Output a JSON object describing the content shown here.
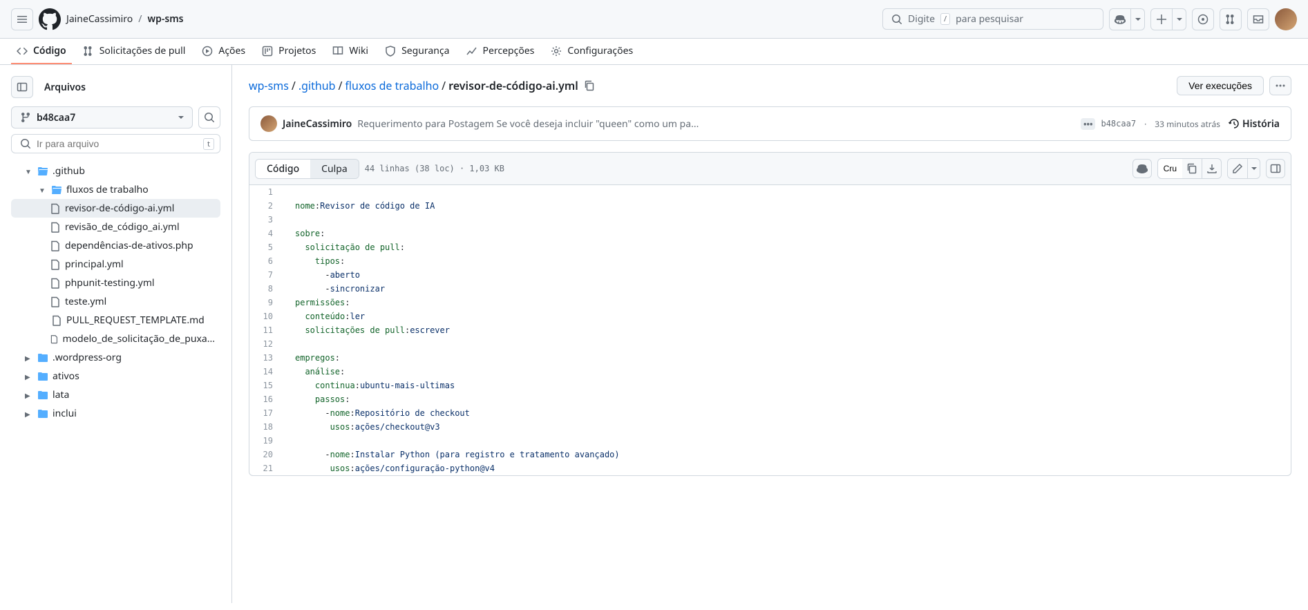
{
  "header": {
    "owner": "JaineCassimiro",
    "repo": "wp-sms",
    "search_placeholder_pre": "Digite",
    "search_placeholder_post": "para pesquisar",
    "search_kbd": "/"
  },
  "nav": {
    "code": "Código",
    "pulls": "Solicitações de pull",
    "actions": "Ações",
    "projects": "Projetos",
    "wiki": "Wiki",
    "security": "Segurança",
    "insights": "Percepções",
    "settings": "Configurações"
  },
  "sidebar": {
    "title": "Arquivos",
    "branch": "b48caa7",
    "filter_placeholder": "Ir para arquivo",
    "filter_kbd": "t",
    "tree": {
      "github": ".github",
      "workflows": "fluxos de trabalho",
      "files": {
        "ai_reviewer": "revisor-de-código-ai.yml",
        "ai_review": "revisão_de_código_ai.yml",
        "asset_deps": "dependências-de-ativos.php",
        "main": "principal.yml",
        "phpunit": "phpunit-testing.yml",
        "test": "teste.yml",
        "pr_template": "PULL_REQUEST_TEMPLATE.md",
        "pr_model": "modelo_de_solicitação_de_puxa..."
      },
      "wordpress_org": ".wordpress-org",
      "ativos": "ativos",
      "lata": "lata",
      "inclui": "inclui"
    }
  },
  "path": {
    "root": "wp-sms",
    "github": ".github",
    "workflows": "fluxos de trabalho",
    "file": "revisor-de-código-ai.yml",
    "run_btn": "Ver execuções"
  },
  "commit": {
    "author": "JaineCassimiro",
    "message": "Requerimento para Postagem Se você deseja incluir \"queen\" como um pa...",
    "sha": "b48caa7",
    "time": "33 minutos atrás",
    "history": "História"
  },
  "file_toolbar": {
    "code": "Código",
    "blame": "Culpa",
    "info": "44 linhas (38 loc) · 1,03 KB",
    "raw": "Cru"
  },
  "code_lines": [
    {
      "n": 1,
      "segs": []
    },
    {
      "n": 2,
      "segs": [
        {
          "t": "nome",
          "c": "tk-key"
        },
        {
          "t": ":",
          "c": "tk-punc"
        },
        {
          "t": "Revisor de código de IA",
          "c": "tk-val"
        }
      ]
    },
    {
      "n": 3,
      "segs": []
    },
    {
      "n": 4,
      "segs": [
        {
          "t": "sobre",
          "c": "tk-key"
        },
        {
          "t": ":",
          "c": "tk-punc"
        }
      ]
    },
    {
      "n": 5,
      "segs": [
        {
          "t": "  ",
          "c": ""
        },
        {
          "t": "solicitação de pull",
          "c": "tk-key"
        },
        {
          "t": ":",
          "c": "tk-punc"
        }
      ]
    },
    {
      "n": 6,
      "segs": [
        {
          "t": "    ",
          "c": ""
        },
        {
          "t": "tipos",
          "c": "tk-key"
        },
        {
          "t": ":",
          "c": "tk-punc"
        }
      ]
    },
    {
      "n": 7,
      "segs": [
        {
          "t": "      -",
          "c": "tk-punc"
        },
        {
          "t": "aberto",
          "c": "tk-val"
        }
      ]
    },
    {
      "n": 8,
      "segs": [
        {
          "t": "      -",
          "c": "tk-punc"
        },
        {
          "t": "sincronizar",
          "c": "tk-val"
        }
      ]
    },
    {
      "n": 9,
      "segs": [
        {
          "t": "permissões",
          "c": "tk-key"
        },
        {
          "t": ":",
          "c": "tk-punc"
        }
      ]
    },
    {
      "n": 10,
      "segs": [
        {
          "t": "  ",
          "c": ""
        },
        {
          "t": "conteúdo",
          "c": "tk-key"
        },
        {
          "t": ":",
          "c": "tk-punc"
        },
        {
          "t": "ler",
          "c": "tk-val"
        }
      ]
    },
    {
      "n": 11,
      "segs": [
        {
          "t": "  ",
          "c": ""
        },
        {
          "t": "solicitações de pull",
          "c": "tk-key"
        },
        {
          "t": ":",
          "c": "tk-punc"
        },
        {
          "t": "escrever",
          "c": "tk-val"
        }
      ]
    },
    {
      "n": 12,
      "segs": []
    },
    {
      "n": 13,
      "segs": [
        {
          "t": "empregos",
          "c": "tk-key"
        },
        {
          "t": ":",
          "c": "tk-punc"
        }
      ]
    },
    {
      "n": 14,
      "segs": [
        {
          "t": "  ",
          "c": ""
        },
        {
          "t": "análise",
          "c": "tk-key"
        },
        {
          "t": ":",
          "c": "tk-punc"
        }
      ]
    },
    {
      "n": 15,
      "segs": [
        {
          "t": "    ",
          "c": ""
        },
        {
          "t": "continua",
          "c": "tk-key"
        },
        {
          "t": ":",
          "c": "tk-punc"
        },
        {
          "t": "ubuntu-mais-ultimas",
          "c": "tk-val"
        }
      ]
    },
    {
      "n": 16,
      "segs": [
        {
          "t": "    ",
          "c": ""
        },
        {
          "t": "passos",
          "c": "tk-key"
        },
        {
          "t": ":",
          "c": "tk-punc"
        }
      ]
    },
    {
      "n": 17,
      "segs": [
        {
          "t": "      -",
          "c": "tk-punc"
        },
        {
          "t": "nome",
          "c": "tk-key"
        },
        {
          "t": ":",
          "c": "tk-punc"
        },
        {
          "t": "Repositório de checkout",
          "c": "tk-val"
        }
      ]
    },
    {
      "n": 18,
      "segs": [
        {
          "t": "       ",
          "c": ""
        },
        {
          "t": "usos",
          "c": "tk-key"
        },
        {
          "t": ":",
          "c": "tk-punc"
        },
        {
          "t": "ações/checkout@v3",
          "c": "tk-val"
        }
      ]
    },
    {
      "n": 19,
      "segs": []
    },
    {
      "n": 20,
      "segs": [
        {
          "t": "      -",
          "c": "tk-punc"
        },
        {
          "t": "nome",
          "c": "tk-key"
        },
        {
          "t": ":",
          "c": "tk-punc"
        },
        {
          "t": "Instalar Python (para registro e tratamento avançado)",
          "c": "tk-val"
        }
      ]
    },
    {
      "n": 21,
      "segs": [
        {
          "t": "       ",
          "c": ""
        },
        {
          "t": "usos",
          "c": "tk-key"
        },
        {
          "t": ":",
          "c": "tk-punc"
        },
        {
          "t": "ações/configuração-python@v4",
          "c": "tk-val"
        }
      ]
    }
  ]
}
